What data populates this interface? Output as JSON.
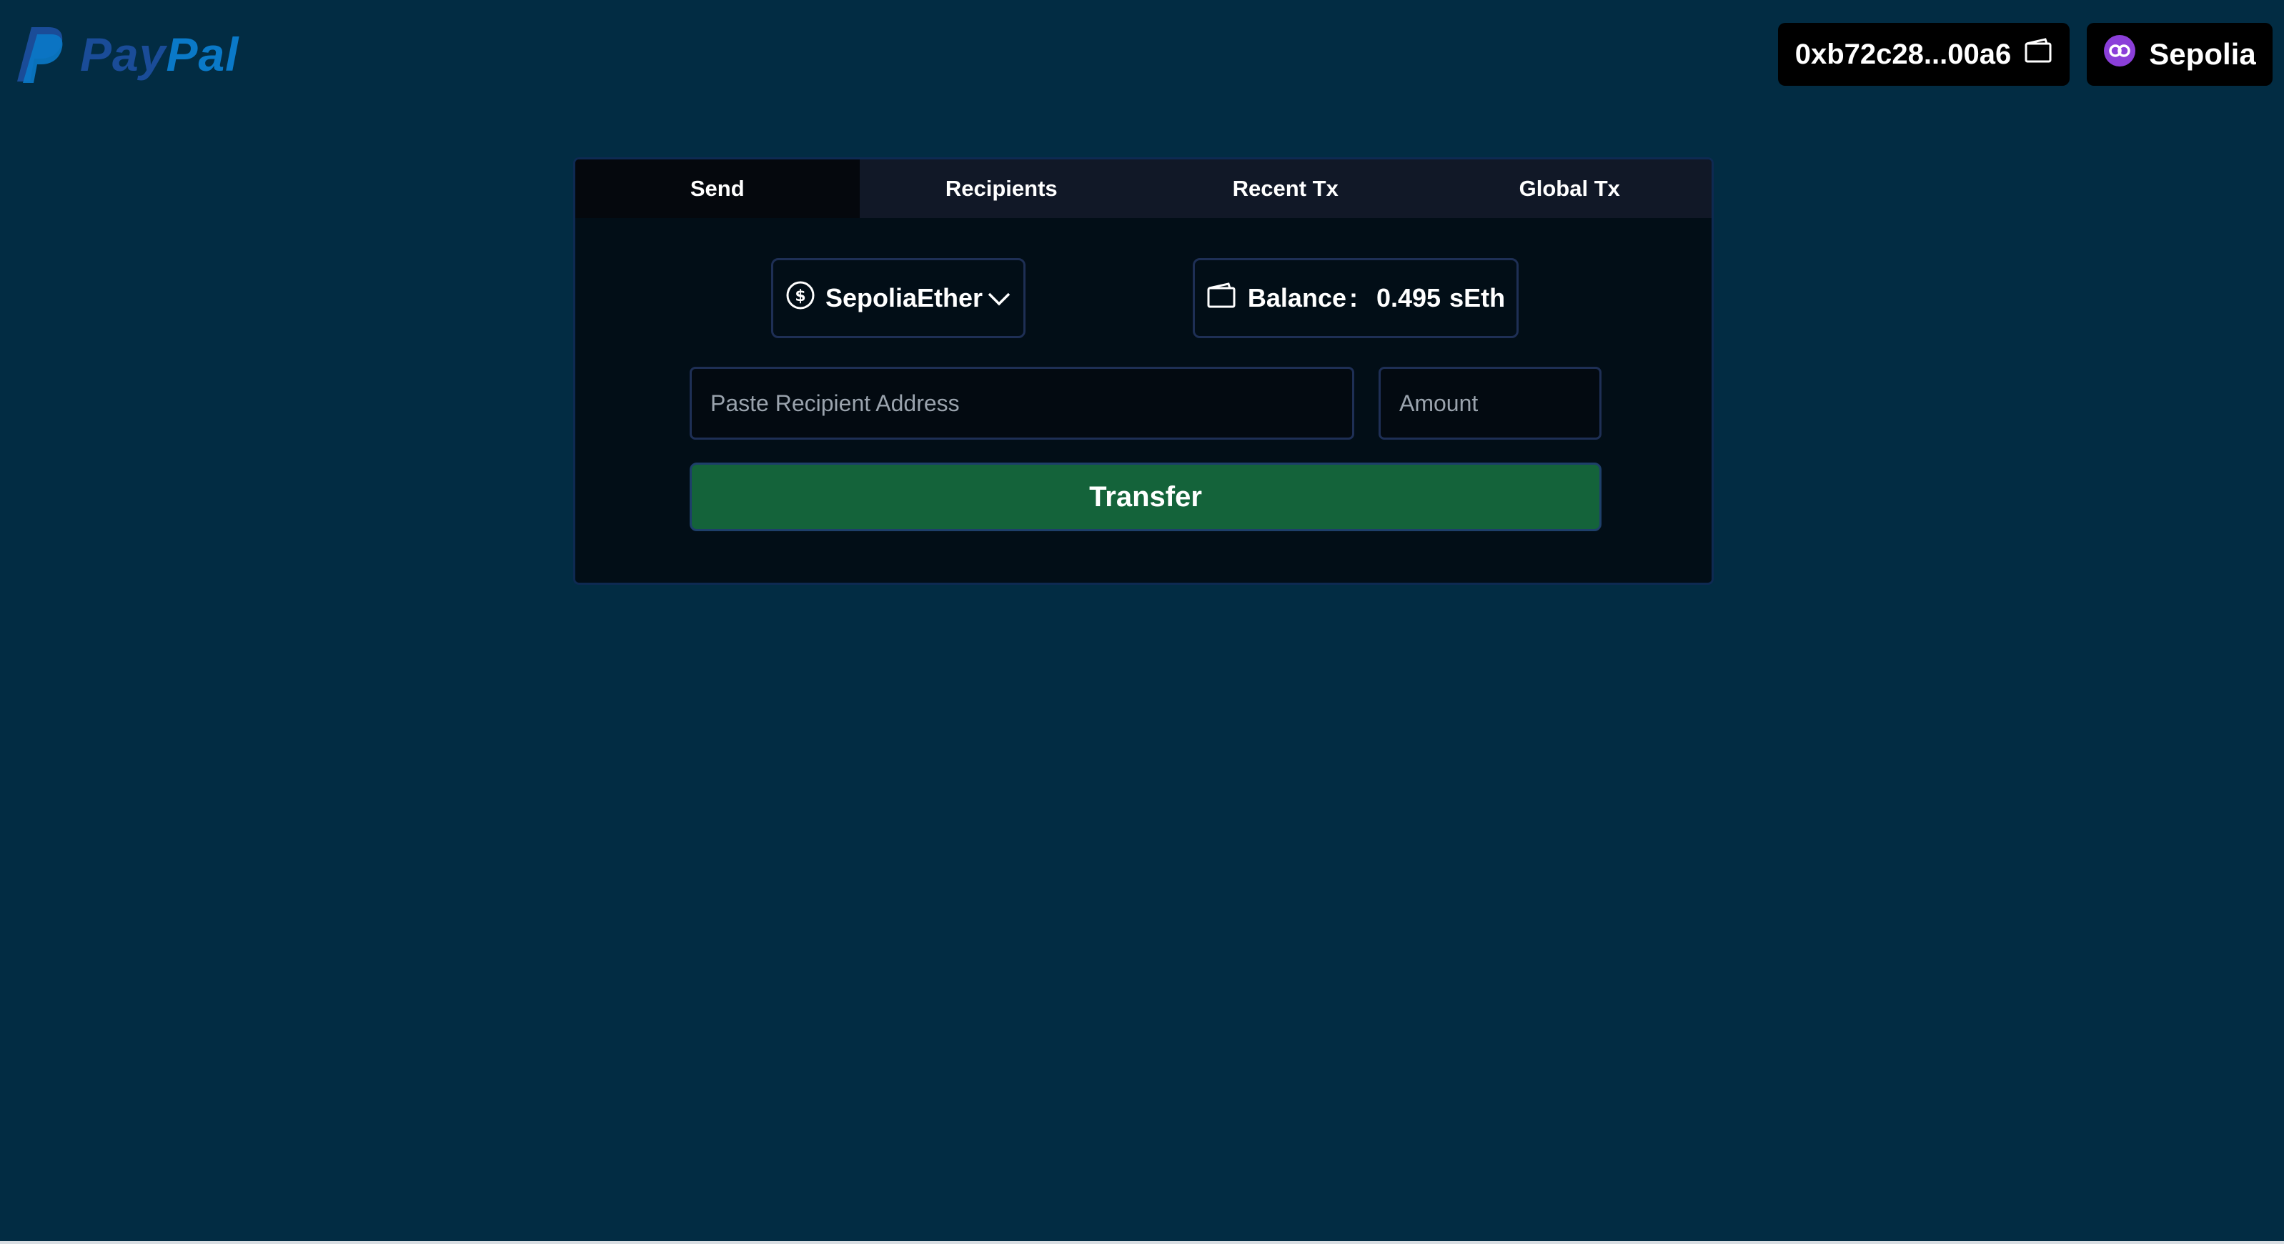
{
  "brand": {
    "logo_icon": "paypal-p-icon",
    "name_part1": "Pay",
    "name_part2": "Pal"
  },
  "header": {
    "wallet_address": "0xb72c28...00a6",
    "wallet_icon": "wallet-icon",
    "network_label": "Sepolia",
    "network_icon": "chain-link-icon"
  },
  "tabs": [
    {
      "label": "Send",
      "active": true
    },
    {
      "label": "Recipients",
      "active": false
    },
    {
      "label": "Recent Tx",
      "active": false
    },
    {
      "label": "Global Tx",
      "active": false
    }
  ],
  "send_form": {
    "token": {
      "selected": "SepoliaEther",
      "icon": "dollar-coin-icon",
      "dropdown_icon": "chevron-down-icon"
    },
    "balance": {
      "label": "Balance",
      "separator": ":",
      "value": "0.495",
      "unit": "sEth",
      "icon": "wallet-icon"
    },
    "recipient_input": {
      "placeholder": "Paste Recipient Address",
      "value": ""
    },
    "amount_input": {
      "placeholder": "Amount",
      "value": ""
    },
    "transfer_label": "Transfer"
  },
  "colors": {
    "page_background": "#022c43",
    "card_background": "#020e17",
    "tab_bar": "#111827",
    "active_tab": "#05080d",
    "transfer_button": "#14633a",
    "logo_dark_blue": "#1a4c98",
    "logo_light_blue": "#0a79c8",
    "network_icon": "#8b3fd9"
  }
}
